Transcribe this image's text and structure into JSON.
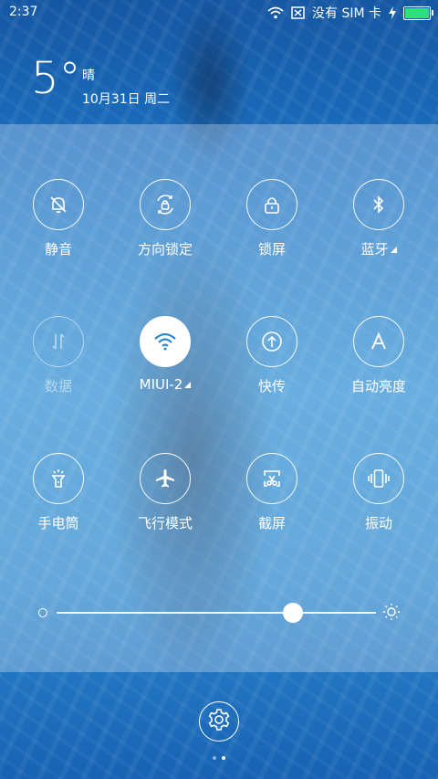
{
  "status_bar": {
    "time": "2:37",
    "carrier": "没有 SIM 卡",
    "battery_level": 1.0,
    "battery_color": "#2ee07a",
    "icons": [
      "wifi-icon",
      "no-sim-icon",
      "charging-icon",
      "battery-icon"
    ]
  },
  "weather": {
    "temperature": "5°",
    "condition": "晴",
    "date": "10月31日 周二"
  },
  "tiles": [
    {
      "label": "静音",
      "icon": "bell-off-icon",
      "state": "off"
    },
    {
      "label": "方向锁定",
      "icon": "rotation-lock-icon",
      "state": "off"
    },
    {
      "label": "锁屏",
      "icon": "lock-icon",
      "state": "off"
    },
    {
      "label": "蓝牙",
      "icon": "bluetooth-icon",
      "state": "off",
      "has_more": true
    },
    {
      "label": "数据",
      "icon": "mobile-data-icon",
      "state": "disabled"
    },
    {
      "label": "MIUI-2",
      "icon": "wifi-icon",
      "state": "on",
      "has_more": true
    },
    {
      "label": "快传",
      "icon": "quick-transfer-icon",
      "state": "off"
    },
    {
      "label": "自动亮度",
      "icon": "auto-brightness-icon",
      "state": "off"
    },
    {
      "label": "手电筒",
      "icon": "flashlight-icon",
      "state": "off"
    },
    {
      "label": "飞行模式",
      "icon": "airplane-icon",
      "state": "off"
    },
    {
      "label": "截屏",
      "icon": "screenshot-icon",
      "state": "off"
    },
    {
      "label": "振动",
      "icon": "vibrate-icon",
      "state": "off"
    }
  ],
  "brightness": {
    "level": 0.74,
    "min_icon": "brightness-low-icon",
    "max_icon": "brightness-high-icon"
  },
  "settings_icon": "gear-icon",
  "pager": {
    "count": 2,
    "current": 1
  },
  "colors": {
    "active_tile_bg": "#ffffff",
    "active_icon": "#2a86cd"
  }
}
